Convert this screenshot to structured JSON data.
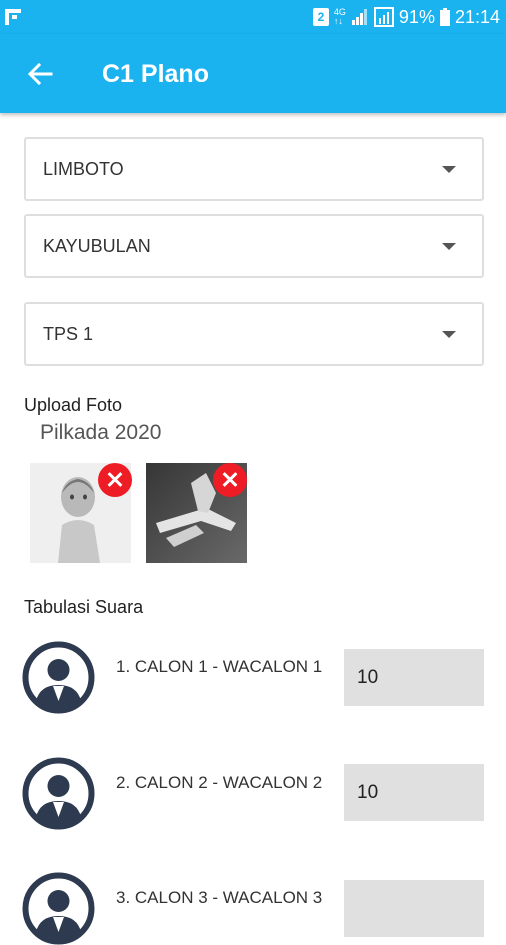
{
  "status_bar": {
    "sim_label": "2",
    "network_top": "4G",
    "network_bottom": "↑↓",
    "battery": "91%",
    "time": "21:14"
  },
  "app_bar": {
    "title": "C1 Plano"
  },
  "selects": [
    {
      "value": "LIMBOTO"
    },
    {
      "value": "KAYUBULAN"
    },
    {
      "value": "TPS 1"
    }
  ],
  "upload": {
    "label": "Upload Foto",
    "subtitle": "Pilkada 2020"
  },
  "tabulation": {
    "label": "Tabulasi Suara",
    "candidates": [
      {
        "name": "1. CALON 1 - WACALON 1",
        "votes": "10"
      },
      {
        "name": "2. CALON 2 - WACALON 2",
        "votes": "10"
      },
      {
        "name": "3. CALON 3 - WACALON 3",
        "votes": ""
      }
    ]
  },
  "colors": {
    "primary": "#1ab3f0",
    "remove": "#ee1c25",
    "avatar": "#2d3a4f"
  }
}
